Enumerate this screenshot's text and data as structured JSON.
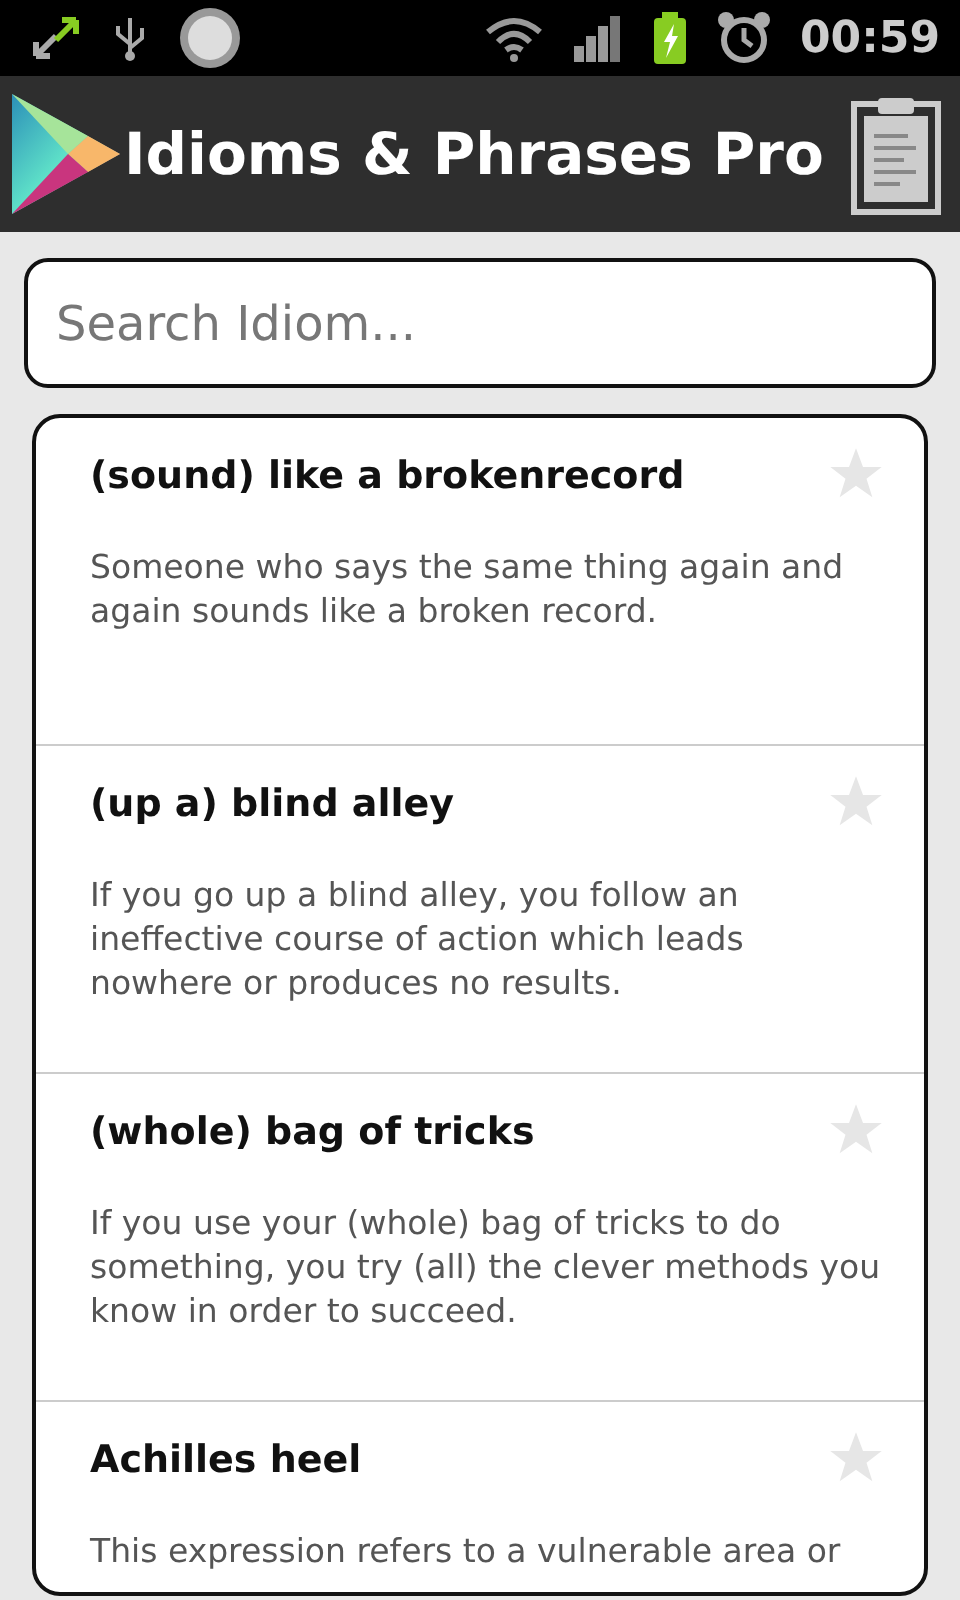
{
  "status_bar": {
    "time": "00:59"
  },
  "app_bar": {
    "title": "Idioms & Phrases Pro"
  },
  "search": {
    "placeholder": "Search Idiom..."
  },
  "idioms": [
    {
      "title": "(sound) like a brokenrecord",
      "meaning": "Someone who says the same thing again and again sounds like a broken record.",
      "starred": false
    },
    {
      "title": "(up a) blind alley",
      "meaning": "If you go up a blind alley, you follow an ineffective course of action which leads nowhere or produces no results.",
      "starred": false
    },
    {
      "title": "(whole) bag of tricks",
      "meaning": "If you use your (whole) bag of tricks to do something, you try (all) the clever methods you know in order to succeed.",
      "starred": false
    },
    {
      "title": "Achilles heel",
      "meaning": "This expression refers to a vulnerable area or",
      "starred": false
    }
  ]
}
